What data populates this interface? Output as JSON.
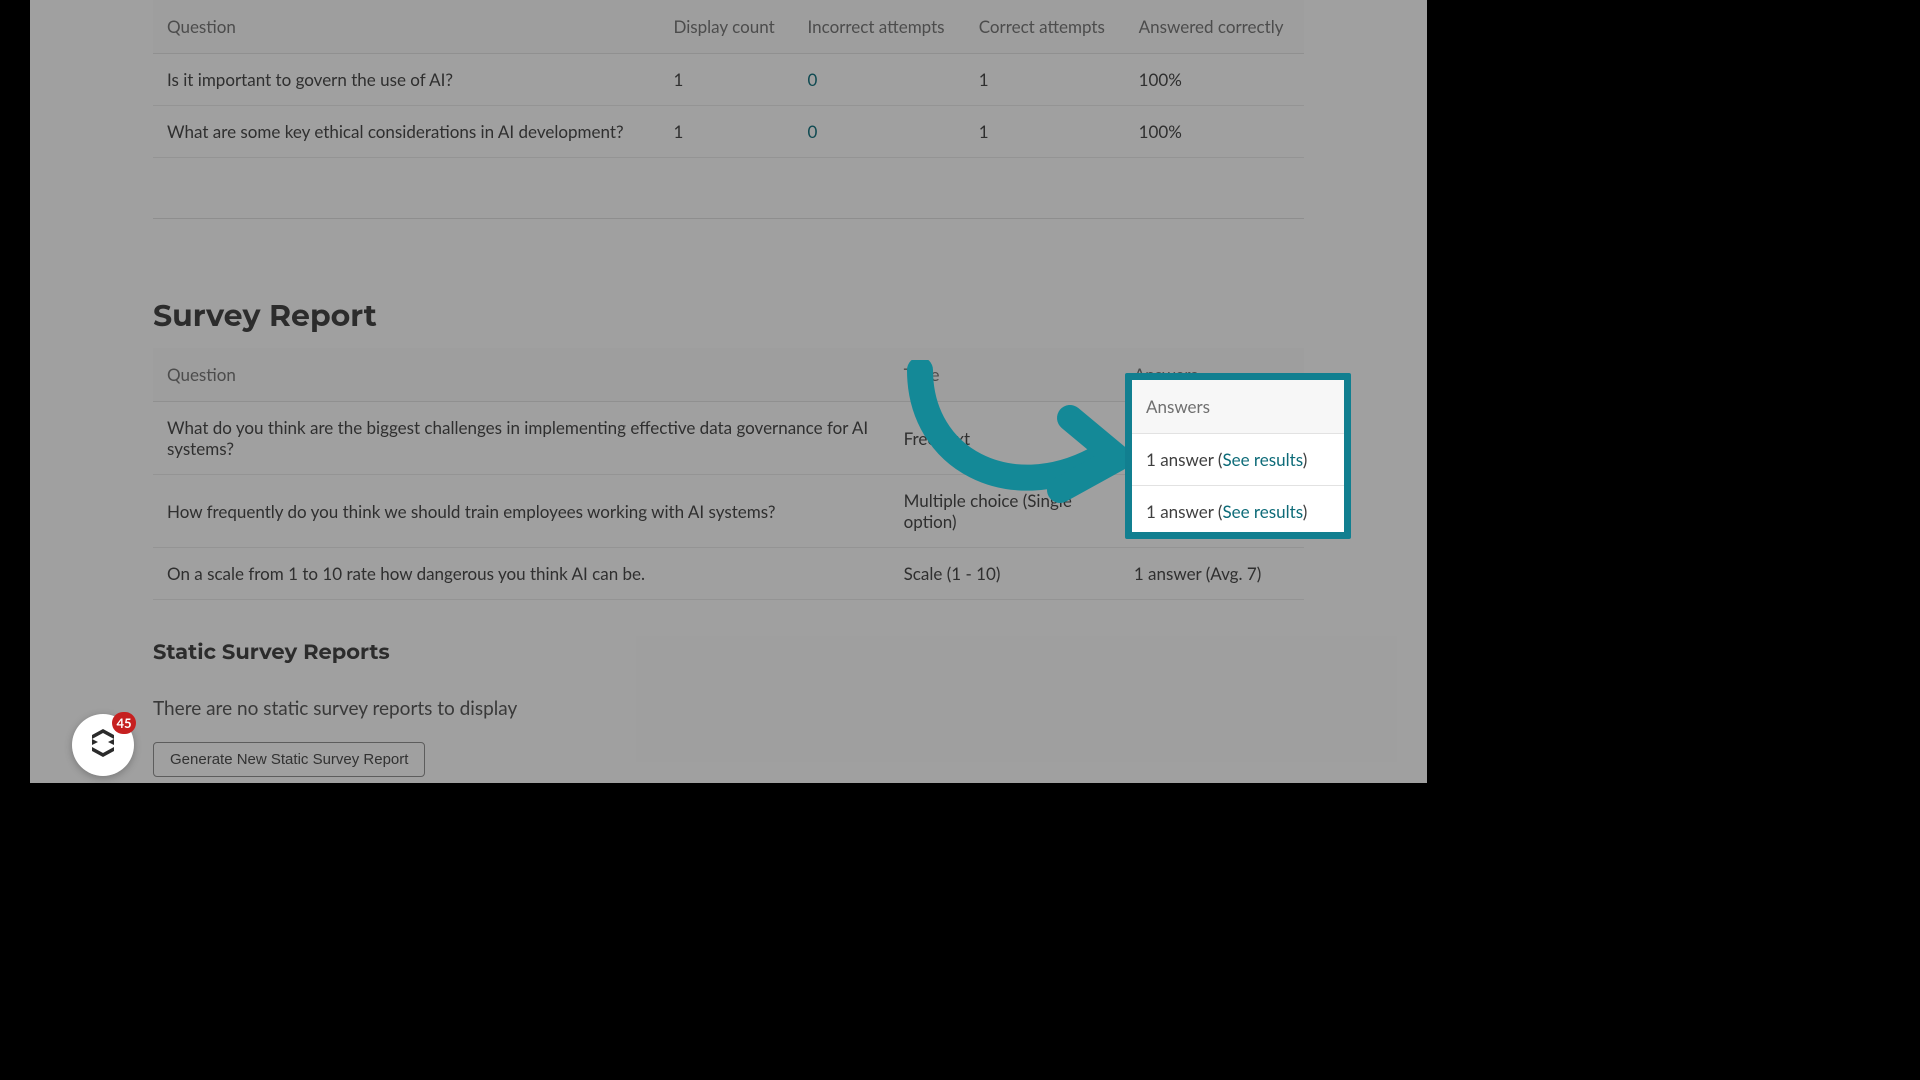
{
  "questions_table": {
    "headers": {
      "question": "Question",
      "display": "Display count",
      "incorrect": "Incorrect attempts",
      "correct": "Correct attempts",
      "answered": "Answered correctly"
    },
    "rows": [
      {
        "question": "Is it important to govern the use of AI?",
        "display": "1",
        "incorrect": "0",
        "correct": "1",
        "answered": "100%"
      },
      {
        "question": "What are some key ethical considerations in AI development?",
        "display": "1",
        "incorrect": "0",
        "correct": "1",
        "answered": "100%"
      }
    ]
  },
  "survey_report": {
    "title": "Survey Report",
    "headers": {
      "question": "Question",
      "type": "Type",
      "answers": "Answers"
    },
    "rows": [
      {
        "question": "What do you think are the biggest challenges in implementing effective data governance for AI systems?",
        "type": "Free text",
        "answers_prefix": "1 answer (",
        "see": "See results",
        "answers_suffix": ")"
      },
      {
        "question": "How frequently do you think we should train employees working with AI systems?",
        "type": "Multiple choice (Single option)",
        "answers_prefix": "1 answer (",
        "see": "See results",
        "answers_suffix": ")"
      },
      {
        "question": "On a scale from 1 to 10 rate how dangerous you think AI can be.",
        "type": "Scale (1 - 10)",
        "answers_text": "1 answer (Avg. 7)"
      }
    ]
  },
  "static_reports": {
    "title": "Static Survey Reports",
    "empty": "There are no static survey reports to display",
    "button": "Generate New Static Survey Report"
  },
  "fab": {
    "badge": "45"
  },
  "highlight": {
    "header": "Answers",
    "rows": [
      {
        "prefix": "1 answer (",
        "see": "See results",
        "suffix": ")"
      },
      {
        "prefix": "1 answer (",
        "see": "See results",
        "suffix": ")"
      }
    ]
  }
}
